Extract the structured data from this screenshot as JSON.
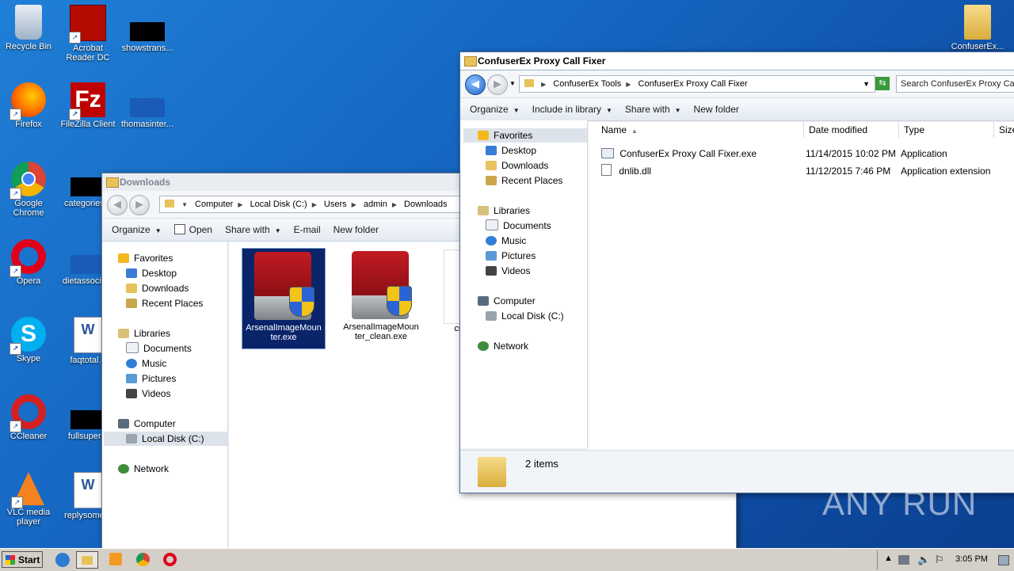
{
  "desktop": {
    "icons": [
      {
        "label": "Recycle Bin"
      },
      {
        "label": "Acrobat Reader DC"
      },
      {
        "label": "showstrans..."
      },
      {
        "label": "Firefox"
      },
      {
        "label": "FileZilla Client"
      },
      {
        "label": "thomasinter..."
      },
      {
        "label": "Google Chrome"
      },
      {
        "label": "categories..."
      },
      {
        "label": "Opera"
      },
      {
        "label": "dietassocia..."
      },
      {
        "label": "Skype"
      },
      {
        "label": "faqtotal..."
      },
      {
        "label": "CCleaner"
      },
      {
        "label": "fullsuper..."
      },
      {
        "label": "VLC media player"
      },
      {
        "label": "replysome..."
      },
      {
        "label": "ConfuserEx..."
      }
    ]
  },
  "downloads_window": {
    "title": "Downloads",
    "breadcrumb": [
      "Computer",
      "Local Disk (C:)",
      "Users",
      "admin",
      "Downloads"
    ],
    "toolbar": [
      "Organize",
      "Open",
      "Share with",
      "E-mail",
      "New folder"
    ],
    "nav": {
      "favorites": "Favorites",
      "desktop": "Desktop",
      "downloads": "Downloads",
      "recent": "Recent Places",
      "libraries": "Libraries",
      "documents": "Documents",
      "music": "Music",
      "pictures": "Pictures",
      "videos": "Videos",
      "computer": "Computer",
      "local_disk": "Local Disk (C:)",
      "network": "Network"
    },
    "files": [
      {
        "name": "ArsenalImageMounter.exe",
        "display": "ArsenalImageMoun ter.exe"
      },
      {
        "name": "ArsenalImageMounter_clean.exe",
        "display": "ArsenalImageMoun ter_clean.exe"
      },
      {
        "name": "cro",
        "display": "cro"
      }
    ]
  },
  "confuser_window": {
    "title": "ConfuserEx Proxy Call Fixer",
    "breadcrumb": [
      "ConfuserEx Tools",
      "ConfuserEx Proxy Call Fixer"
    ],
    "search_placeholder": "Search ConfuserEx Proxy Cal",
    "toolbar": [
      "Organize",
      "Include in library",
      "Share with",
      "New folder"
    ],
    "nav": {
      "favorites": "Favorites",
      "desktop": "Desktop",
      "downloads": "Downloads",
      "recent": "Recent Places",
      "libraries": "Libraries",
      "documents": "Documents",
      "music": "Music",
      "pictures": "Pictures",
      "videos": "Videos",
      "computer": "Computer",
      "local_disk": "Local Disk (C:)",
      "network": "Network"
    },
    "columns": [
      "Name",
      "Date modified",
      "Type",
      "Size"
    ],
    "rows": [
      {
        "name": "ConfuserEx Proxy Call Fixer.exe",
        "date": "11/14/2015 10:02 PM",
        "type": "Application"
      },
      {
        "name": "dnlib.dll",
        "date": "11/12/2015 7:46 PM",
        "type": "Application extension"
      }
    ],
    "status": "2 items"
  },
  "taskbar": {
    "start_label": "Start",
    "clock": "3:05 PM"
  },
  "watermark": "ANY RUN"
}
